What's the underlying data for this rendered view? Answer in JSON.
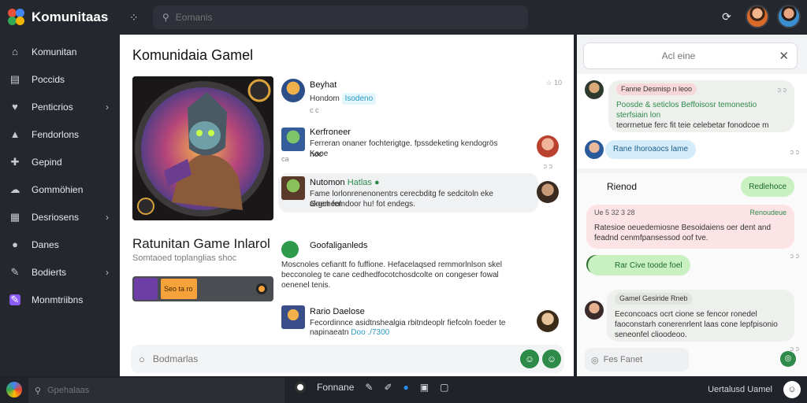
{
  "app": {
    "title": "Komunitaas"
  },
  "search": {
    "placeholder": "Eomanis"
  },
  "sidebar": {
    "items": [
      {
        "label": "Komunitan",
        "icon": "home-icon",
        "chevron": false
      },
      {
        "label": "Poccids",
        "icon": "list-icon",
        "chevron": false
      },
      {
        "label": "Penticrios",
        "icon": "heart-icon",
        "chevron": true
      },
      {
        "label": "Fendorlons",
        "icon": "shop-icon",
        "chevron": false
      },
      {
        "label": "Gepind",
        "icon": "puzzle-icon",
        "chevron": false
      },
      {
        "label": "Gommöhien",
        "icon": "chat-icon",
        "chevron": false
      },
      {
        "label": "Desriosens",
        "icon": "grid-icon",
        "chevron": true
      },
      {
        "label": "Danes",
        "icon": "location-icon",
        "chevron": false
      },
      {
        "label": "Bodierts",
        "icon": "tools-icon",
        "chevron": true
      },
      {
        "label": "Monmtriibns",
        "icon": "pen-icon",
        "chevron": false
      }
    ]
  },
  "main": {
    "title": "Komunidaia Gamel",
    "game_title": "Ratunitan Game Inlarol",
    "game_subtitle": "Somtaoed toplanglias shoc",
    "progress_label": "Seo ta ro"
  },
  "posts": [
    {
      "name": "Beyhat",
      "sub": "Hondom",
      "tag": "Isodeno",
      "meta": "c c",
      "text": "",
      "time": "☆ 10"
    },
    {
      "name": "Kerfroneer",
      "text": "Ferreran onaner fochterigtge. fpssdeketing kendogrös Kaoe",
      "text2": "hoc",
      "sub2": "ca"
    },
    {
      "name": "Nutomon",
      "tag2": "Hatlas",
      "text": "Fame lorlonrenenonentrs cerecbditg fe sedcitoln eke akgcheol",
      "text2": "Gnerr femdoor hu! fot endegs."
    },
    {
      "name": "Goofaliganleds",
      "text": "Moscnoles cefiantt fo fuffione. Hefacelaqsed remmorlnlson skel",
      "text2": "becconoleg te cane cedhedfocotchosdcolte on congeser fowal",
      "text3": "oenenel tenis."
    },
    {
      "name": "Rario Daelose",
      "text": "Fecordinnce asidtnshealgia rbitndeoplr fiefcoln foeder te",
      "text2": "napinaeatn",
      "tag3": "Doo ./7300"
    }
  ],
  "compose": {
    "placeholder": "Bodmarlas"
  },
  "right": {
    "search_placeholder": "Acl eine",
    "messages": [
      {
        "name": "Fanne Desmisp n leoo",
        "text": "Poosde & seticlos Beffoisosr temonestio sterfsiain lon",
        "text2": "teorrnetue ferc fit teie celebetar fonodcoe m",
        "time": "ɔ ɔ"
      },
      {
        "chip": "Rane Ihoroaocs lame",
        "time": "ɔ ɔ"
      },
      {
        "title": "Rienod",
        "chip": "Redlehoce"
      },
      {
        "name": "Ue 5 32 3 28",
        "badge": "Renoudeue",
        "text": "Ratesioe oeuedemiosne Besoidaiens oer dent and",
        "text2": "feadnd cenmfpansessod oof tve.",
        "time": "ɔ ɔ"
      },
      {
        "chip": "Rar Cive toode foel"
      },
      {
        "name": "Gamel Gesiride Rneb",
        "text": "Eeconcoacs ocrt cione se fencor ronedel",
        "text2": "faoconstarh conerenrlent laas cone lepfpisonio",
        "text3": "seneonfel clioodeoo.",
        "time": "ɔ ɔ"
      }
    ],
    "compose_placeholder": "Fes Fanet"
  },
  "bottom": {
    "search_placeholder": "Gpehalaas",
    "app_label": "Fonnane",
    "status": "Uertalusd Uamel"
  }
}
